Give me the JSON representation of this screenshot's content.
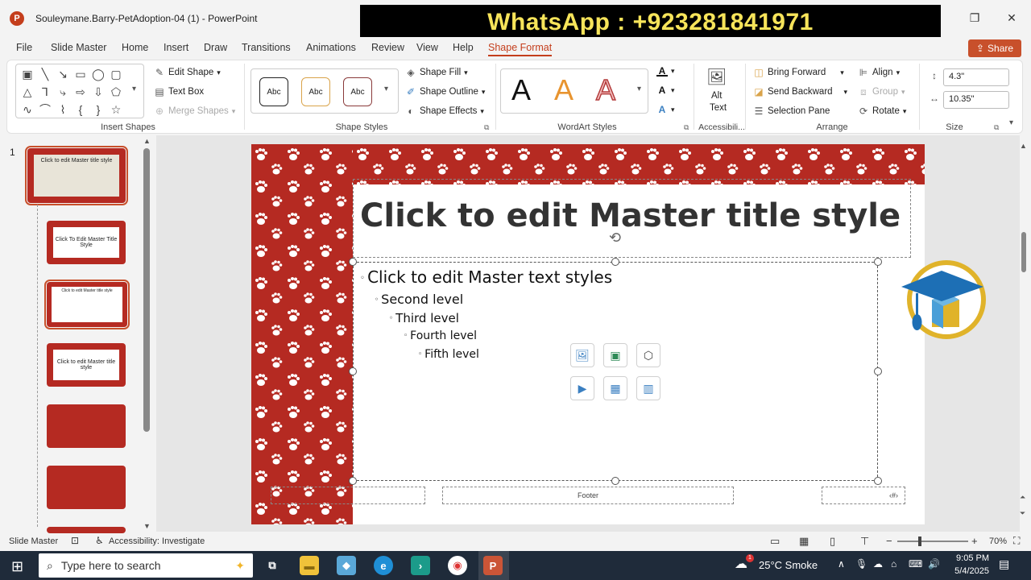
{
  "titlebar": {
    "app_logo": "P",
    "doc_title": "Souleymane.Barry-PetAdoption-04 (1)  -  PowerPoint"
  },
  "banner": {
    "text": "WhatsApp : +923281841971"
  },
  "menu": {
    "items": [
      "File",
      "Slide Master",
      "Home",
      "Insert",
      "Draw",
      "Transitions",
      "Animations",
      "Review",
      "View",
      "Help",
      "Shape Format"
    ],
    "active": "Shape Format",
    "share_label": "Share"
  },
  "ribbon": {
    "insert_shapes": {
      "label": "Insert Shapes",
      "edit_shape": "Edit Shape",
      "text_box": "Text Box",
      "merge_shapes": "Merge Shapes"
    },
    "shape_styles": {
      "label": "Shape Styles",
      "sample": "Abc",
      "fill": "Shape Fill",
      "outline": "Shape Outline",
      "effects": "Shape Effects"
    },
    "wordart": {
      "label": "WordArt Styles",
      "letter": "A"
    },
    "accessibility": {
      "label": "Accessibili...",
      "alt_text_1": "Alt",
      "alt_text_2": "Text"
    },
    "arrange": {
      "label": "Arrange",
      "bring_forward": "Bring Forward",
      "send_backward": "Send Backward",
      "selection_pane": "Selection Pane",
      "align": "Align",
      "group": "Group",
      "rotate": "Rotate"
    },
    "size": {
      "label": "Size",
      "height": "4.3\"",
      "width": "10.35\""
    }
  },
  "thumbnails": {
    "slide_number": "1",
    "master_title": "Click to edit Master title style",
    "layout2": "Click To Edit Master Title Style",
    "layout3": "Click to edit Master title style",
    "layout4": "Click to edit Master title style"
  },
  "slide": {
    "title": "Click to edit Master title style",
    "levels": [
      "Click to edit Master text styles",
      "Second level",
      "Third level",
      "Fourth level",
      "Fifth level"
    ],
    "footer": "Footer"
  },
  "statusbar": {
    "mode": "Slide Master",
    "accessibility": "Accessibility: Investigate",
    "zoom": "70%"
  },
  "taskbar": {
    "search_placeholder": "Type here to search",
    "weather": "25°C  Smoke",
    "time": "9:05 PM",
    "date": "5/4/2025",
    "weather_badge": "1"
  },
  "colors": {
    "accent": "#c43e1c",
    "paw_red": "#b52a22",
    "taskbar": "#1f2b3a",
    "banner_text": "#f7e45a"
  }
}
